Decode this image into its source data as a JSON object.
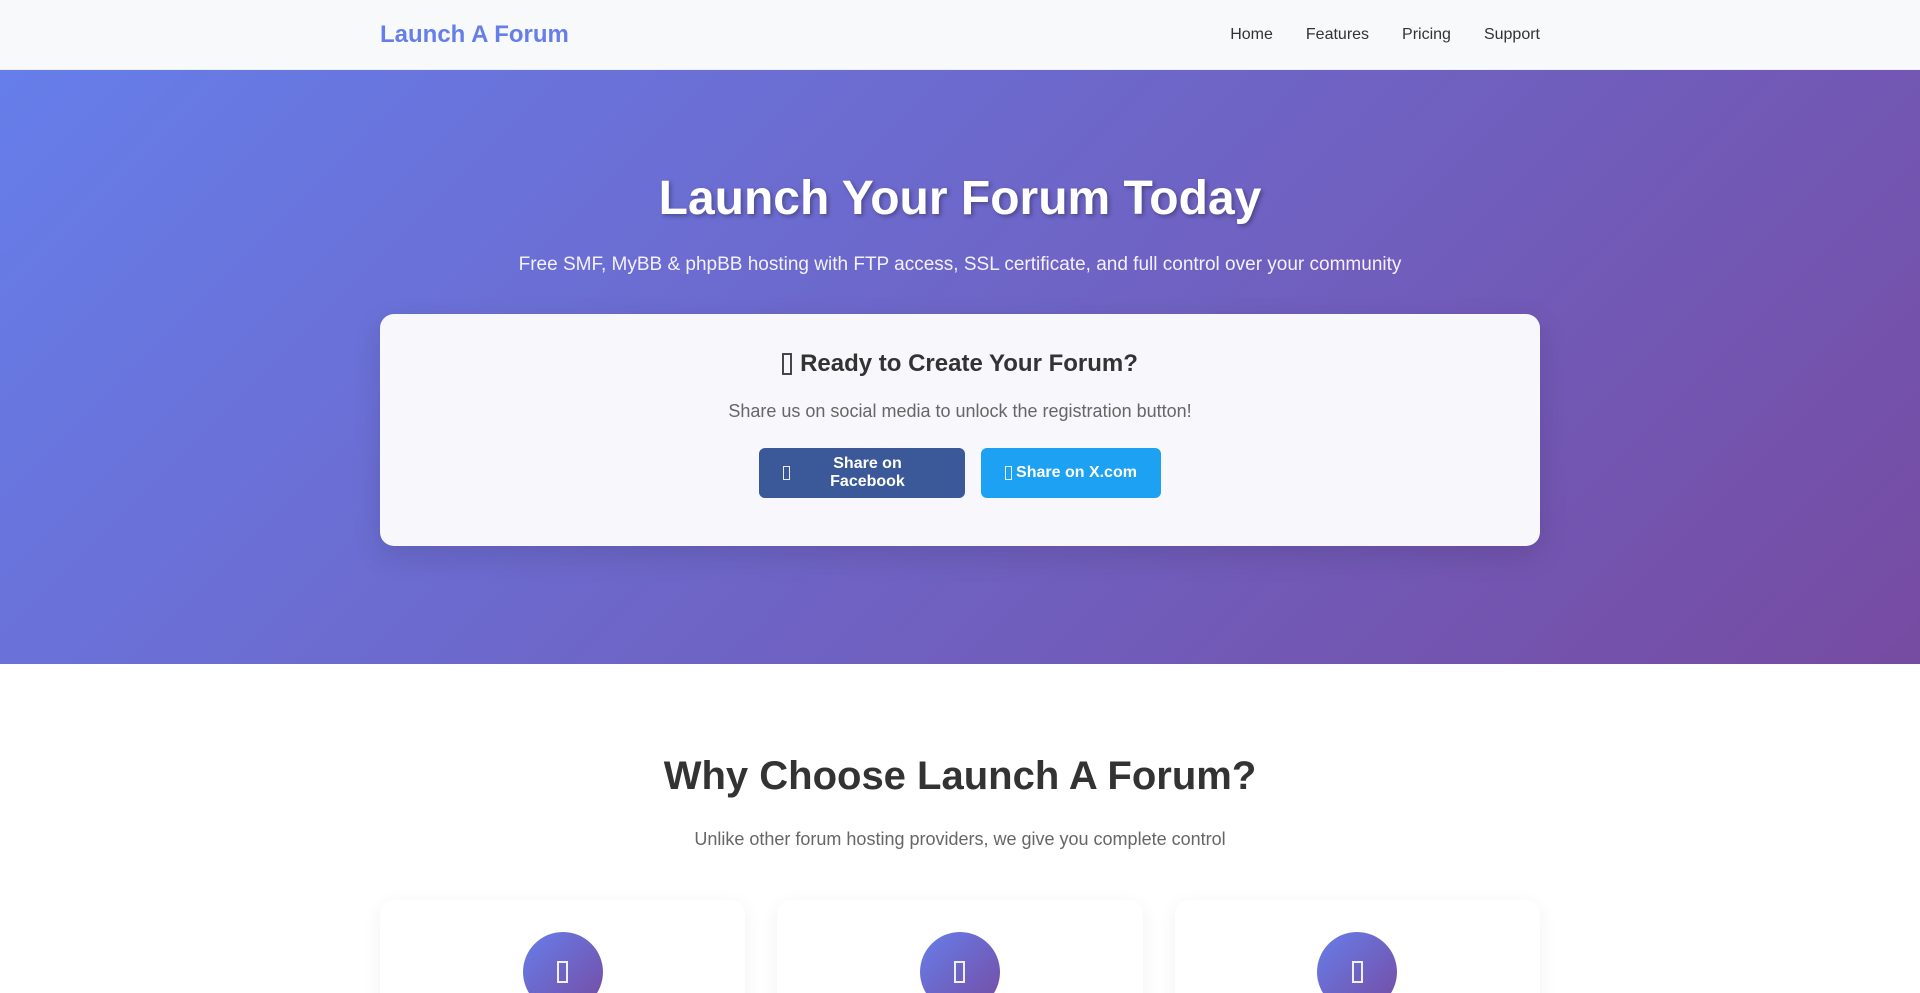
{
  "nav": {
    "logo": "Launch A Forum",
    "links": [
      "Home",
      "Features",
      "Pricing",
      "Support"
    ]
  },
  "hero": {
    "title": "Launch Your Forum Today",
    "subtitle": "Free SMF, MyBB & phpBB hosting with FTP access, SSL certificate, and full control over your community"
  },
  "cta": {
    "title": "Ready to Create Your Forum?",
    "subtitle": "Share us on social media to unlock the registration button!",
    "facebook_label": "Share on Facebook",
    "x_label": "Share on X.com"
  },
  "features": {
    "title": "Why Choose Launch A Forum?",
    "subtitle": "Unlike other forum hosting providers, we give you complete control"
  },
  "icons": {
    "cta": "rocket-icon",
    "facebook": "facebook-icon",
    "x": "x-icon",
    "features": [
      "feature-icon-1",
      "feature-icon-2",
      "feature-icon-3"
    ]
  },
  "colors": {
    "brand": "#667eea",
    "gradient_start": "#667eea",
    "gradient_end": "#764ba2",
    "facebook": "#3b5998",
    "x": "#1da1f2"
  }
}
